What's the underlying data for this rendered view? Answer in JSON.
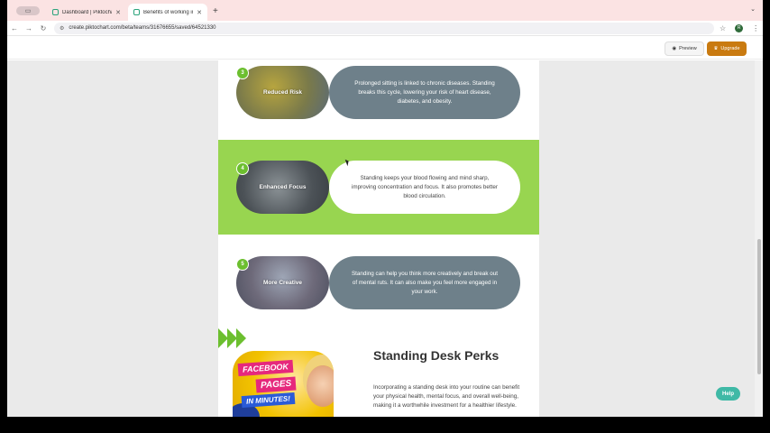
{
  "browser": {
    "tabs": [
      {
        "label": "Dashboard | Piktochart",
        "active": false
      },
      {
        "label": "Benefits of working in a stan...",
        "active": true
      }
    ],
    "new_tab_symbol": "+",
    "url": "create.piktochart.com/beta/teams/31676655/saved/64521330",
    "profile_initial": "R"
  },
  "toolbar": {
    "preview_label": "Preview",
    "upgrade_label": "Upgrade"
  },
  "content": {
    "items": [
      {
        "number": "3",
        "title": "Reduced Risk",
        "text": "Prolonged sitting is linked to chronic diseases. Standing breaks this cycle, lowering your risk of heart disease, diabetes, and obesity."
      },
      {
        "number": "4",
        "title": "Enhanced Focus",
        "text": "Standing keeps your blood flowing and mind sharp, improving concentration and focus. It also promotes better blood circulation."
      },
      {
        "number": "5",
        "title": "More Creative",
        "text": "Standing can help you think more creatively and break out of mental ruts. It can also make you feel more engaged in your work."
      }
    ],
    "perks_title": "Standing Desk Perks",
    "perks_body": "Incorporating a standing desk into your routine can benefit your physical health, mental focus, and overall well-being, making it a worthwhile investment for a healthier lifestyle.",
    "promo_image": {
      "line1": "FACEBOOK",
      "line2": "PAGES",
      "line3": "IN MINUTES!"
    }
  },
  "help_label": "Help",
  "colors": {
    "accent_green": "#98d550",
    "badge_green": "#6cbf2f",
    "pill_dark": "#6e808a",
    "upgrade": "#c97a10",
    "help": "#3fb9a6"
  }
}
